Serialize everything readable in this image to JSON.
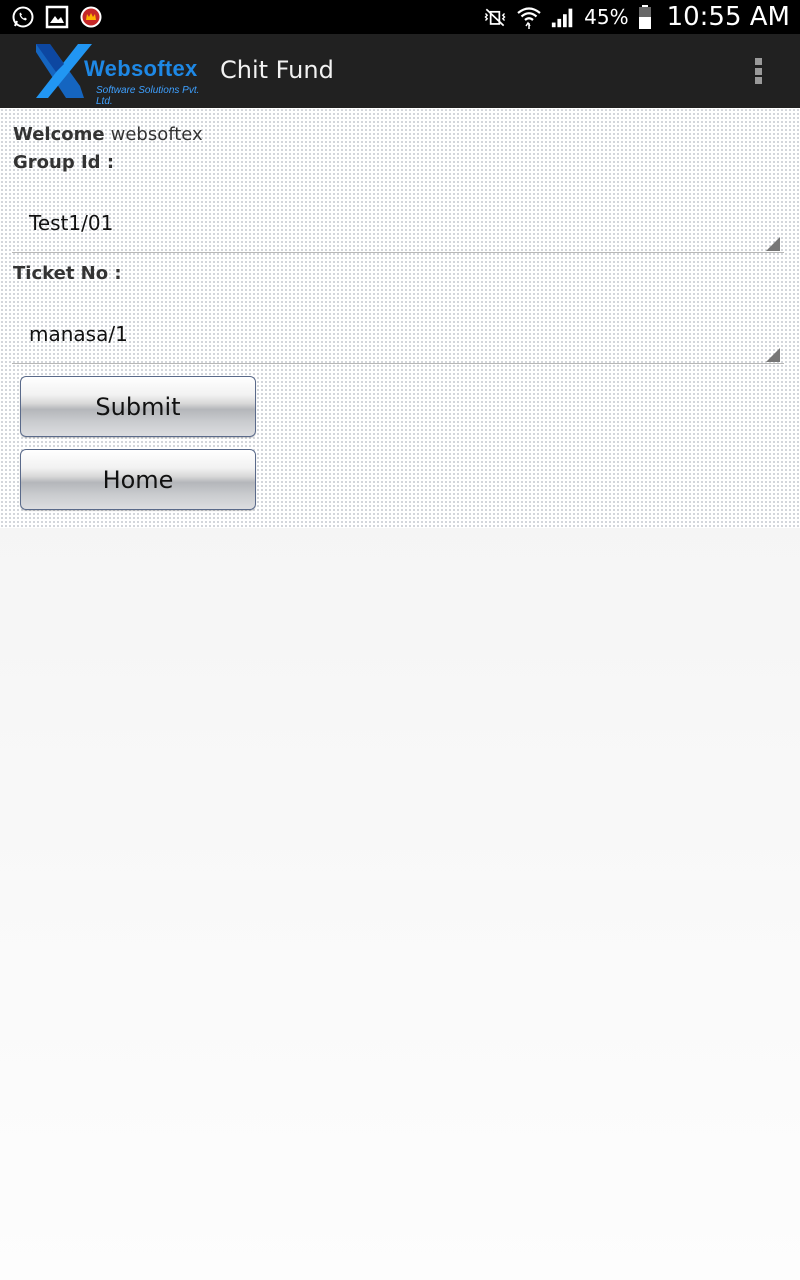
{
  "status_bar": {
    "battery_percent": "45%",
    "time": "10:55 AM",
    "icons_left": [
      "whatsapp-icon",
      "gallery-icon",
      "notification-app-icon"
    ],
    "icons_right": [
      "vibrate-mute-icon",
      "wifi-icon",
      "signal-icon",
      "battery-icon"
    ]
  },
  "action_bar": {
    "logo_title": "Websoftex",
    "logo_subtitle": "Software Solutions Pvt. Ltd.",
    "title": "Chit Fund",
    "overflow_icon": "overflow-menu-icon"
  },
  "form": {
    "welcome_label": "Welcome",
    "welcome_user": "websoftex",
    "group_id_label": "Group Id :",
    "group_id_value": "Test1/01",
    "ticket_no_label": "Ticket No :",
    "ticket_no_value": "manasa/1",
    "submit_label": "Submit",
    "home_label": "Home"
  },
  "colors": {
    "action_bar_bg": "#212121",
    "brand_blue": "#1e88e5"
  }
}
